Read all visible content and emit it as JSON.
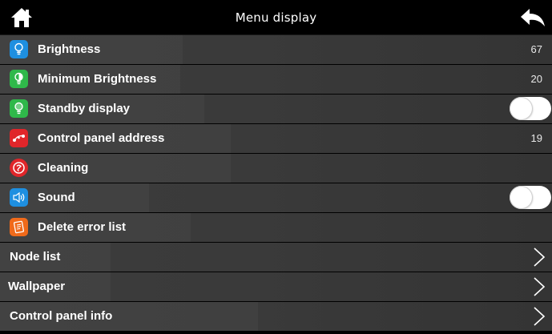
{
  "header": {
    "title": "Menu display",
    "home_icon": "home-icon",
    "back_icon": "back-arrow-icon"
  },
  "items": [
    {
      "label": "Brightness",
      "value": "67",
      "icon": "bulb-icon",
      "icon_color": "#1e8fe0"
    },
    {
      "label": "Minimum Brightness",
      "value": "20",
      "icon": "bulb-dim-icon",
      "icon_color": "#2fb84a"
    },
    {
      "label": "Standby display",
      "toggle": "off",
      "icon": "bulb-standby-icon",
      "icon_color": "#2fb84a"
    },
    {
      "label": "Control panel address",
      "value": "19",
      "icon": "address-icon",
      "icon_color": "#e0262a"
    },
    {
      "label": "Cleaning",
      "icon": "cleaning-icon",
      "icon_color": "#e0262a"
    },
    {
      "label": "Sound",
      "toggle": "off",
      "icon": "speaker-icon",
      "icon_color": "#1e8fe0"
    },
    {
      "label": "Delete error list",
      "icon": "delete-list-icon",
      "icon_color": "#f06a1a"
    },
    {
      "label": "Node list",
      "chevron": true
    },
    {
      "label": "Wallpaper",
      "chevron": true
    },
    {
      "label": "Control panel info",
      "chevron": true
    }
  ]
}
